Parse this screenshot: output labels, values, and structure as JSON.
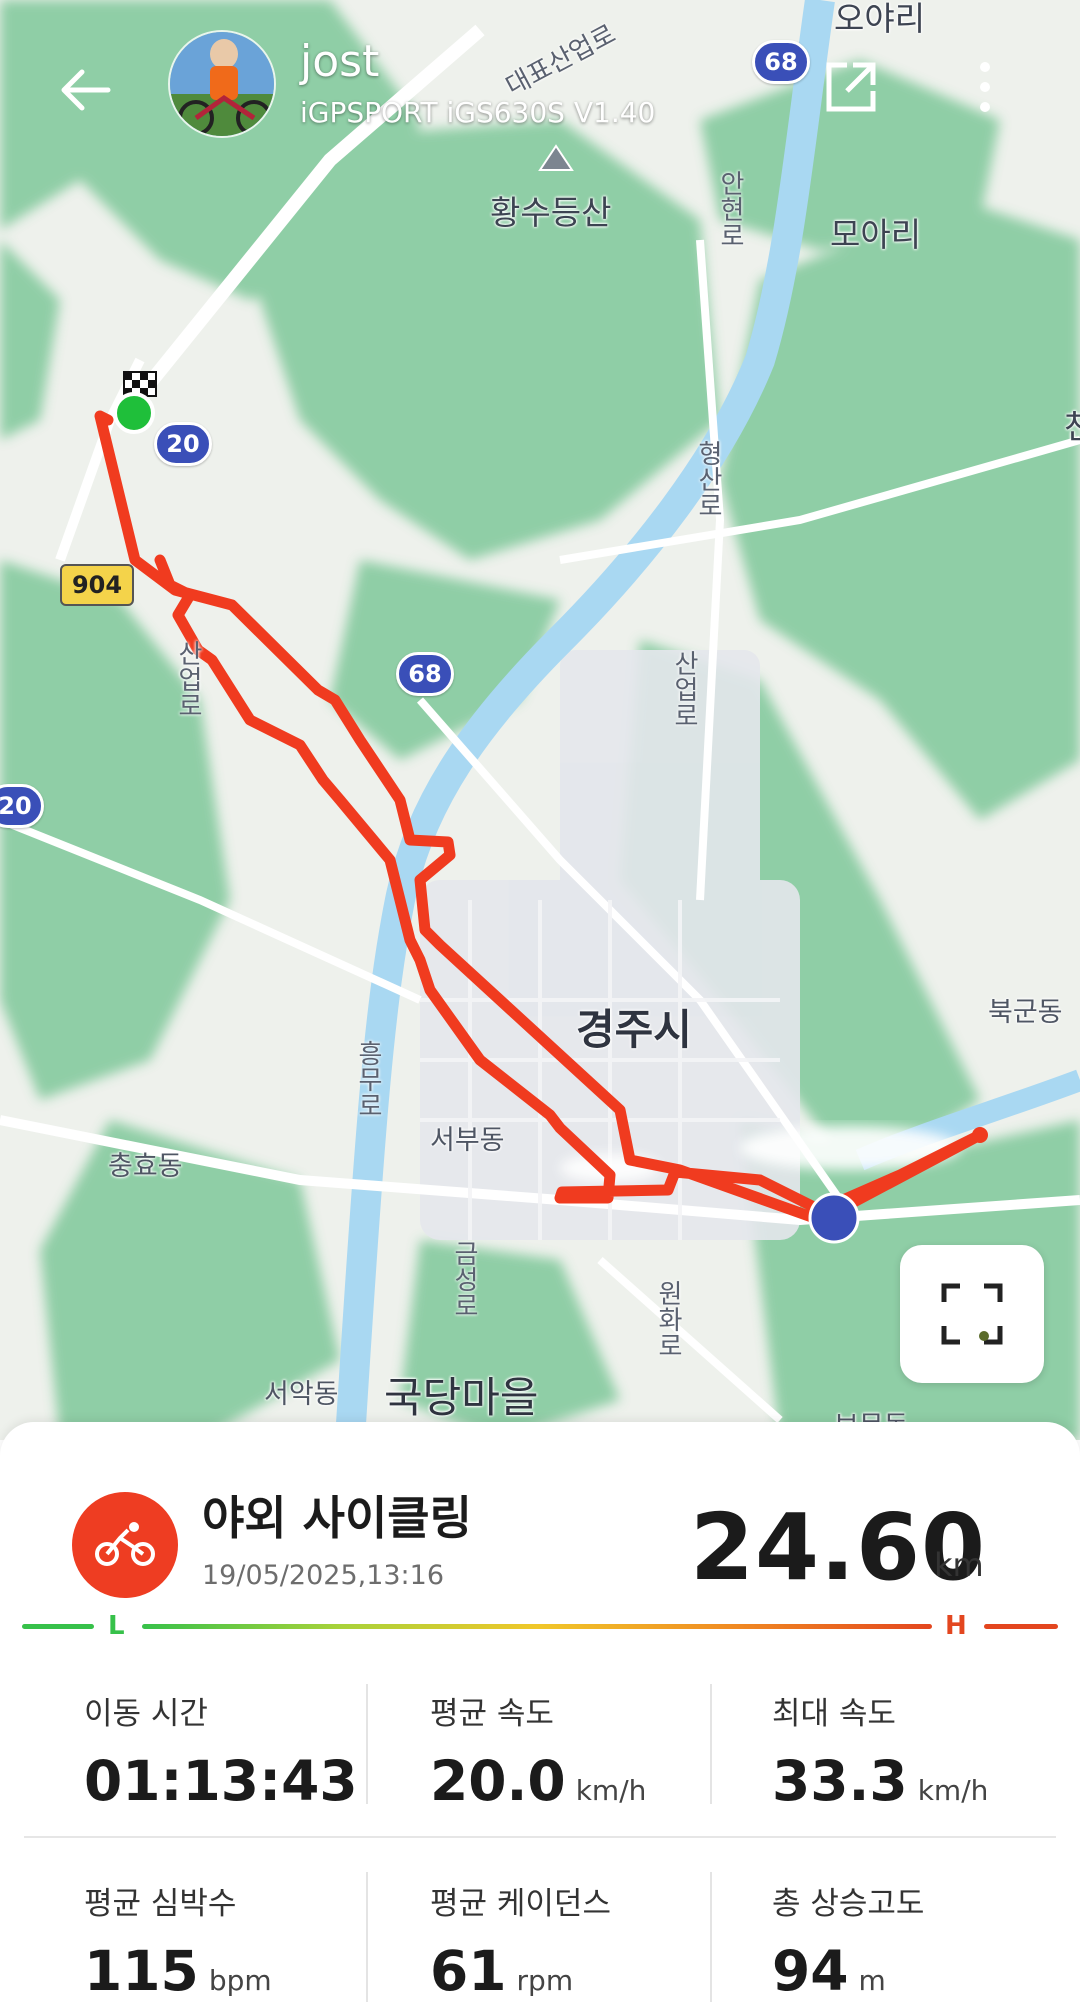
{
  "header": {
    "user_name": "jost",
    "device": "iGPSPORT iGS630S  V1.40"
  },
  "map": {
    "places": [
      {
        "text": "오야리"
      },
      {
        "text": "황수등산"
      },
      {
        "text": "모아리"
      },
      {
        "text": "경주시"
      },
      {
        "text": "북군동"
      },
      {
        "text": "서부동"
      },
      {
        "text": "충효동"
      },
      {
        "text": "국당마을"
      },
      {
        "text": "서악동"
      },
      {
        "text": "보문동"
      },
      {
        "text": "천"
      }
    ],
    "road_names": [
      "안현로",
      "형산로",
      "산업로",
      "흥무로",
      "금성로",
      "원화로",
      "산업로",
      "대표산업로"
    ],
    "shields": [
      {
        "text": "68"
      },
      {
        "text": "20"
      },
      {
        "text": "68"
      },
      {
        "text": "20"
      }
    ],
    "local_road": "904",
    "route_color": "#f03b1f",
    "start_color": "#1fbf3a"
  },
  "activity": {
    "type": "야외 사이클링",
    "datetime": "19/05/2025,13:16",
    "distance": "24.60",
    "distance_unit": "km",
    "icon": "bicycle-icon",
    "icon_color": "#ee3d22"
  },
  "hr_legend": {
    "low": "L",
    "high": "H"
  },
  "stats": [
    {
      "label": "이동 시간",
      "value": "01:13:43",
      "unit": ""
    },
    {
      "label": "평균 속도",
      "value": "20.0",
      "unit": "km/h"
    },
    {
      "label": "최대 속도",
      "value": "33.3",
      "unit": "km/h"
    },
    {
      "label": "평균 심박수",
      "value": "115",
      "unit": "bpm"
    },
    {
      "label": "평균 케이던스",
      "value": "61",
      "unit": "rpm"
    },
    {
      "label": "총 상승고도",
      "value": "94",
      "unit": "m"
    }
  ]
}
